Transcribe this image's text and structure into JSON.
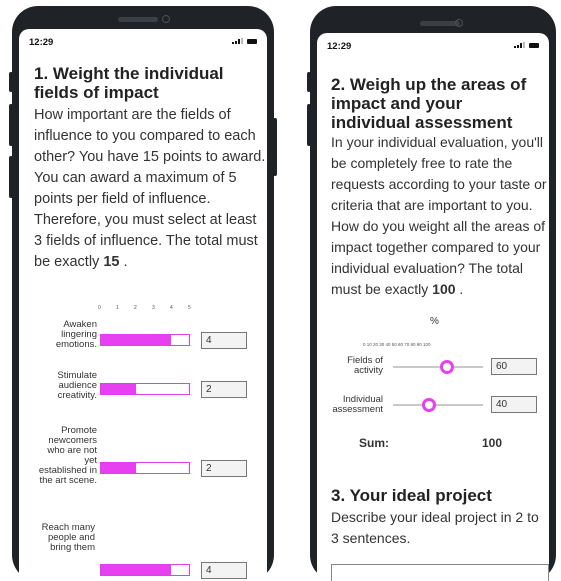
{
  "left": {
    "time": "12:29",
    "heading": "1. Weight the individual fields of impact",
    "intro": "How important are the fields of influence to you compared to each other? You have 15 points to award. You can award a maximum of 5 points per field of influence. Therefore, you must select at least 3 fields of influence. The total must be exactly",
    "total": "15",
    "end": ".",
    "scale_ticks": [
      "0",
      "1",
      "2",
      "3",
      "4",
      "5"
    ],
    "max_points": 5,
    "rows": [
      {
        "label": "Awaken lingering emotions.",
        "value": 4,
        "display": "4"
      },
      {
        "label": "Stimulate audience creativity.",
        "value": 2,
        "display": "2"
      },
      {
        "label": "Promote newcomers who are not yet established in the art scene.",
        "value": 2,
        "display": "2"
      },
      {
        "label": "Reach many people and bring them",
        "value": 4,
        "display": "4"
      }
    ]
  },
  "right": {
    "time": "12:29",
    "heading": "2. Weigh up the areas of impact and your individual assessment",
    "intro": "In your individual evaluation, you'll be completely free to rate the requests according to your taste or criteria that are important to you. How do you weight all the areas of impact together compared to your individual evaluation? The total must be exactly",
    "total": "100",
    "end": ".",
    "unit": "%",
    "scale_ticks": "0 10 20 30 40 50 60 70 80 90 100",
    "sliders": [
      {
        "label": "Fields of activity",
        "value": 60,
        "display": "60"
      },
      {
        "label": "Individual assessment",
        "value": 40,
        "display": "40"
      }
    ],
    "sum_label": "Sum:",
    "sum_value": "100",
    "section3_heading": "3. Your ideal project",
    "section3_text": "Describe your ideal project in 2 to 3 sentences."
  },
  "accent_color": "#e740f0"
}
